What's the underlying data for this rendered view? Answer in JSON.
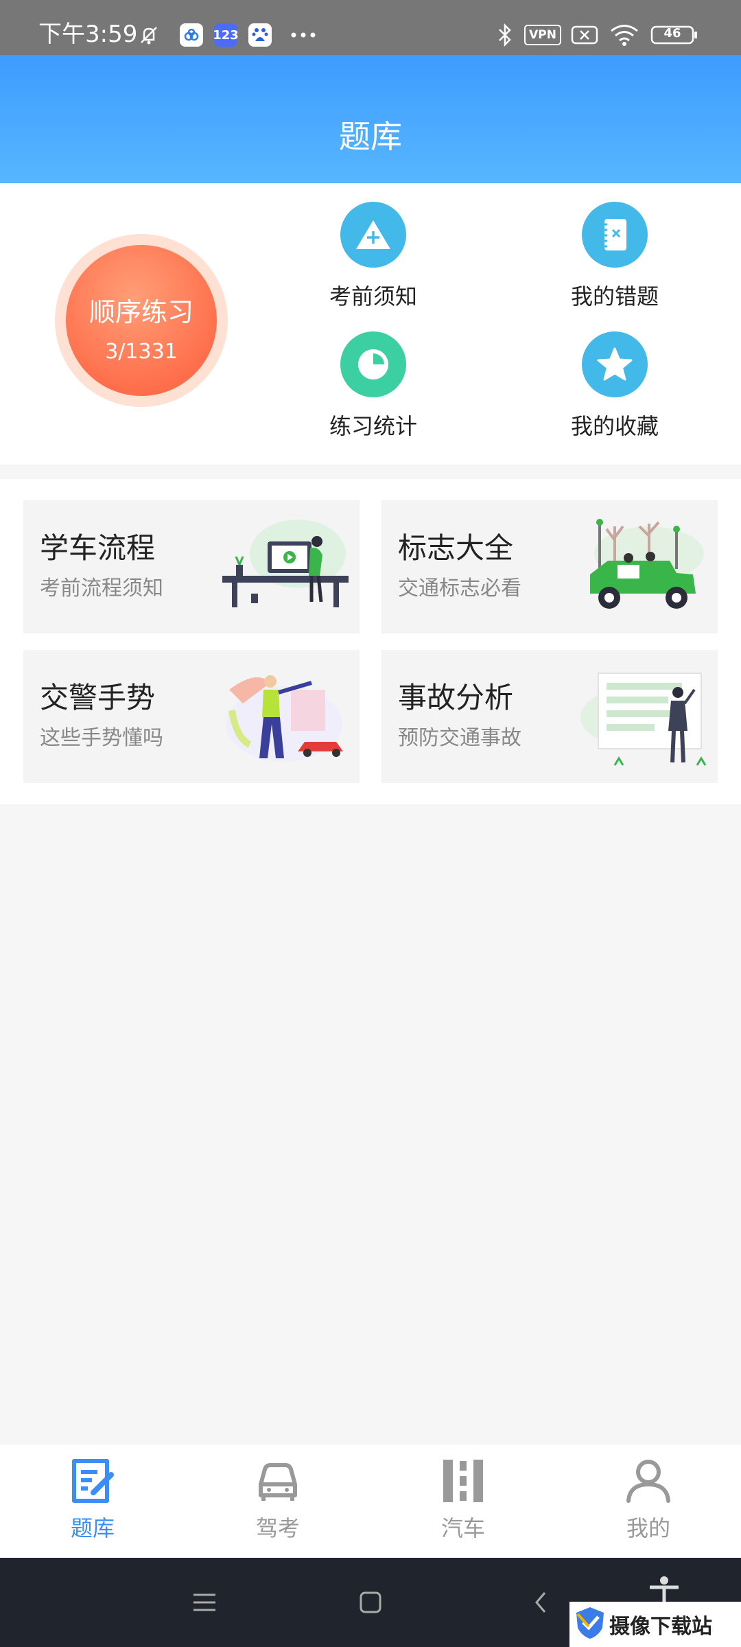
{
  "status_bar": {
    "time": "下午3:59",
    "icons": [
      "mute-icon",
      "app-cloud-icon",
      "app-123-icon",
      "app-baidu-icon",
      "more-dots-icon",
      "bluetooth-icon",
      "vpn-icon",
      "sim-off-icon",
      "wifi-icon",
      "battery-icon"
    ],
    "vpn_label": "VPN",
    "app_123_label": "123",
    "battery_level": "46"
  },
  "header": {
    "title": "题库"
  },
  "practice": {
    "title": "顺序练习",
    "progress": "3/1331"
  },
  "quick_actions": [
    {
      "label": "考前须知",
      "icon": "triangle-plus-icon",
      "color": "#42b9e8"
    },
    {
      "label": "我的错题",
      "icon": "notebook-x-icon",
      "color": "#42b9e8"
    },
    {
      "label": "练习统计",
      "icon": "pie-chart-icon",
      "color": "#3ccfa2"
    },
    {
      "label": "我的收藏",
      "icon": "star-icon",
      "color": "#42b9e8"
    }
  ],
  "cards": [
    {
      "title": "学车流程",
      "subtitle": "考前流程须知",
      "icon": "study-desk-illustration"
    },
    {
      "title": "标志大全",
      "subtitle": "交通标志必看",
      "icon": "jeep-illustration"
    },
    {
      "title": "交警手势",
      "subtitle": "这些手势懂吗",
      "icon": "traffic-police-illustration"
    },
    {
      "title": "事故分析",
      "subtitle": "预防交通事故",
      "icon": "whiteboard-illustration"
    }
  ],
  "tab_bar": [
    {
      "label": "题库",
      "icon": "question-bank-icon",
      "active": true
    },
    {
      "label": "驾考",
      "icon": "car-icon",
      "active": false
    },
    {
      "label": "汽车",
      "icon": "road-icon",
      "active": false
    },
    {
      "label": "我的",
      "icon": "profile-icon",
      "active": false
    }
  ],
  "colors": {
    "accent": "#3a8ef6",
    "practice_orange": "#ff6f4c",
    "header_blue": "#3d9cff"
  },
  "watermark": {
    "text": "摄像下载站"
  }
}
